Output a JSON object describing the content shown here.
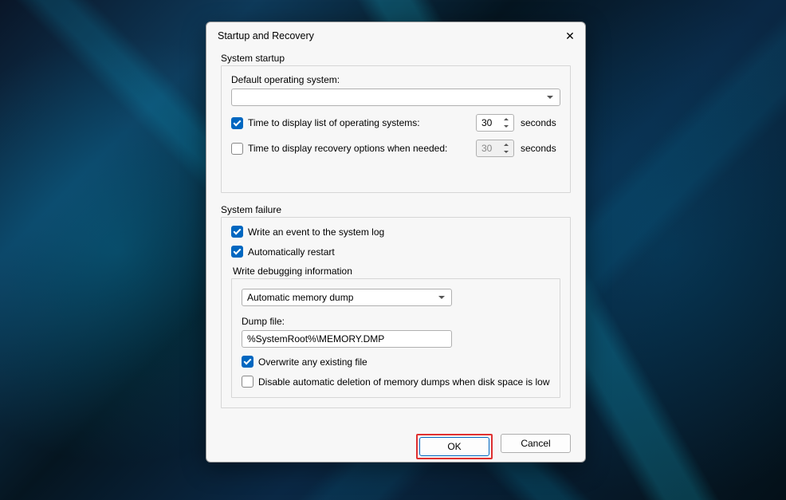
{
  "dialog": {
    "title": "Startup and Recovery",
    "startup": {
      "legend": "System startup",
      "default_os_label": "Default operating system:",
      "default_os_value": "",
      "time_list": {
        "checked": true,
        "label": "Time to display list of operating systems:",
        "value": "30",
        "unit": "seconds"
      },
      "time_recovery": {
        "checked": false,
        "label": "Time to display recovery options when needed:",
        "value": "30",
        "unit": "seconds"
      }
    },
    "failure": {
      "legend": "System failure",
      "write_event": {
        "checked": true,
        "label": "Write an event to the system log"
      },
      "auto_restart": {
        "checked": true,
        "label": "Automatically restart"
      },
      "debug": {
        "legend": "Write debugging information",
        "dump_type": "Automatic memory dump",
        "dump_file_label": "Dump file:",
        "dump_file_value": "%SystemRoot%\\MEMORY.DMP",
        "overwrite": {
          "checked": true,
          "label": "Overwrite any existing file"
        },
        "disable_auto_delete": {
          "checked": false,
          "label": "Disable automatic deletion of memory dumps when disk space is low"
        }
      }
    },
    "buttons": {
      "ok": "OK",
      "cancel": "Cancel"
    }
  }
}
